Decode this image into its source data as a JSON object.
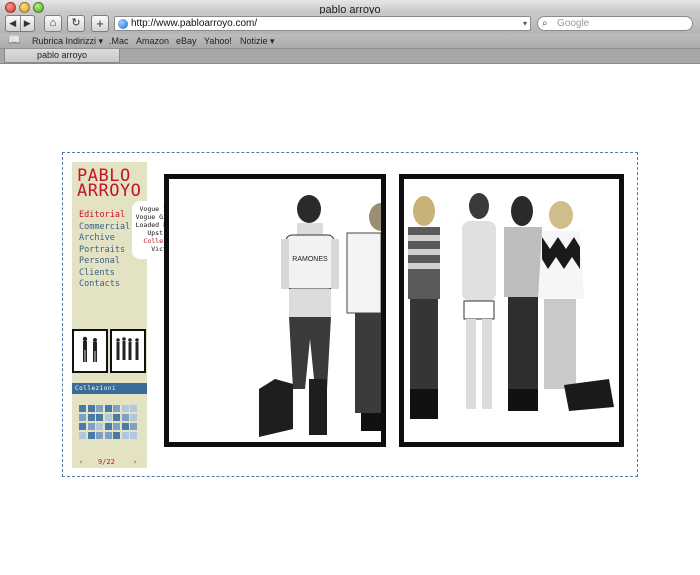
{
  "window": {
    "title": "pablo arroyo"
  },
  "toolbar": {
    "back_glyph": "◀",
    "forward_glyph": "▶",
    "home_glyph": "⌂",
    "reload_glyph": "↻",
    "add_glyph": "+",
    "url": "http://www.pabloarroyo.com/",
    "url_dropdown_glyph": "▾",
    "search_placeholder": "Google",
    "search_glyph": "⌕"
  },
  "bookmarks": [
    {
      "label": "Rubrica Indirizzi ▾"
    },
    {
      "label": ".Mac"
    },
    {
      "label": "Amazon"
    },
    {
      "label": "eBay"
    },
    {
      "label": "Yahoo!"
    },
    {
      "label": "Notizie ▾"
    }
  ],
  "book_glyph": "📖",
  "tab": {
    "label": "pablo arroyo"
  },
  "site": {
    "logo": {
      "line1": "PABLO",
      "line2": "ARROYO"
    },
    "menu": [
      {
        "label": "Editorial",
        "active": true
      },
      {
        "label": "Commercial",
        "active": false
      },
      {
        "label": "Archive",
        "active": false
      },
      {
        "label": "Portraits",
        "active": false
      },
      {
        "label": "Personal",
        "active": false
      },
      {
        "label": "Clients",
        "active": false
      },
      {
        "label": "Contacts",
        "active": false
      }
    ],
    "submenu": [
      {
        "label": "Vogue Italia",
        "active": false
      },
      {
        "label": "Vogue Gioiello",
        "active": false
      },
      {
        "label": "Loaded Fashion",
        "active": false
      },
      {
        "label": "Upstreet",
        "active": false
      },
      {
        "label": "Collezioni",
        "active": true
      },
      {
        "label": "Victim",
        "active": false
      }
    ],
    "collections_header": "Collezioni",
    "pager": {
      "prev": "‹",
      "count": "9/22",
      "next": "›"
    },
    "colors": {
      "accent_red": "#c41425",
      "menu_blue": "#3a5f86",
      "sidebar_beige": "#e3e2c2",
      "header_blue": "#3b6b99",
      "grid_dark": "#4a7aa8",
      "grid_mid": "#7fa2c4",
      "grid_light": "#b3c7da"
    },
    "collection_grid": [
      [
        "dark",
        "dark",
        "mid",
        "dark",
        "mid",
        "light",
        "light"
      ],
      [
        "mid",
        "dark",
        "dark",
        "light",
        "dark",
        "mid",
        "light"
      ],
      [
        "dark",
        "mid",
        "light",
        "dark",
        "mid",
        "dark",
        "mid"
      ],
      [
        "light",
        "dark",
        "mid",
        "mid",
        "dark",
        "light",
        "light"
      ]
    ]
  }
}
